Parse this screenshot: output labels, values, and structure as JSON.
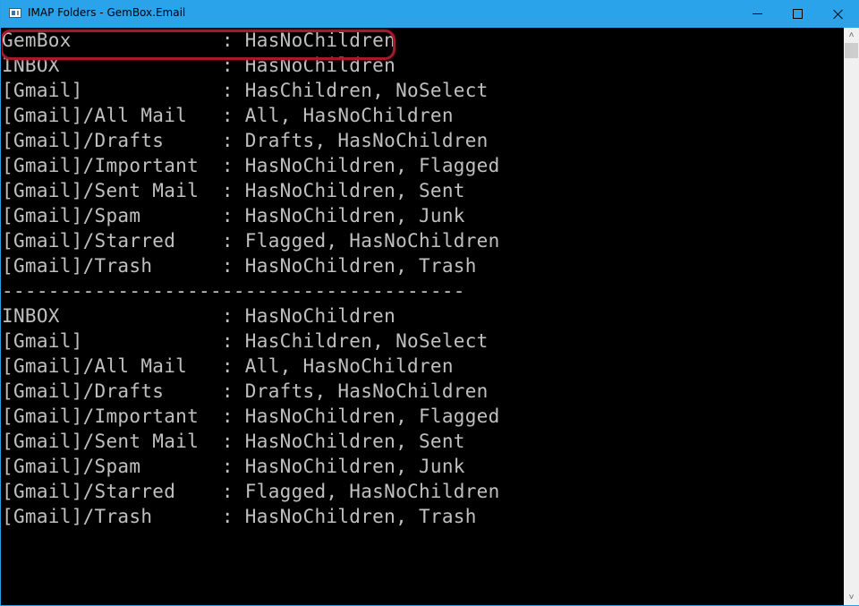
{
  "window": {
    "title": "IMAP Folders - GemBox.Email",
    "buttons": {
      "minimize": "minimize",
      "maximize": "maximize",
      "close": "close"
    }
  },
  "console": {
    "lines": [
      "GemBox             : HasNoChildren",
      "INBOX              : HasNoChildren",
      "[Gmail]            : HasChildren, NoSelect",
      "[Gmail]/All Mail   : All, HasNoChildren",
      "[Gmail]/Drafts     : Drafts, HasNoChildren",
      "[Gmail]/Important  : HasNoChildren, Flagged",
      "[Gmail]/Sent Mail  : HasNoChildren, Sent",
      "[Gmail]/Spam       : HasNoChildren, Junk",
      "[Gmail]/Starred    : Flagged, HasNoChildren",
      "[Gmail]/Trash      : HasNoChildren, Trash",
      "----------------------------------------",
      "INBOX              : HasNoChildren",
      "[Gmail]            : HasChildren, NoSelect",
      "[Gmail]/All Mail   : All, HasNoChildren",
      "[Gmail]/Drafts     : Drafts, HasNoChildren",
      "[Gmail]/Important  : HasNoChildren, Flagged",
      "[Gmail]/Sent Mail  : HasNoChildren, Sent",
      "[Gmail]/Spam       : HasNoChildren, Junk",
      "[Gmail]/Starred    : Flagged, HasNoChildren",
      "[Gmail]/Trash      : HasNoChildren, Trash"
    ],
    "highlight_color": "#a01b2c",
    "text_color": "#c0c0c0"
  },
  "scrollbar": {
    "up_glyph": "˄",
    "down_glyph": "˅"
  }
}
